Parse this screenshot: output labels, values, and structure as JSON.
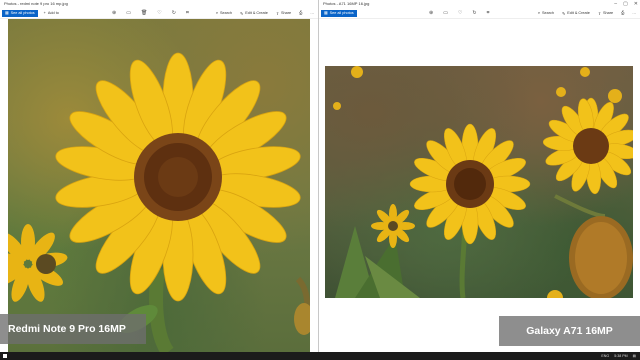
{
  "left_window": {
    "title": "Photos - redmi note 9 pro 16 mp.jpg",
    "see_all": "See all photos",
    "add_to": "Add to",
    "search": "Search",
    "edit_create": "Edit & Create",
    "share": "Share",
    "caption": "Redmi Note 9 Pro 16MP"
  },
  "right_window": {
    "title": "Photos - A71 16MP 16.jpg",
    "see_all": "See all photos",
    "search": "Search",
    "edit_create": "Edit & Create",
    "share": "Share",
    "caption": "Galaxy A71 16MP"
  },
  "taskbar": {
    "time": "5:38 PM",
    "lang": "ENG"
  },
  "icons": {
    "zoom": "zoom-icon",
    "slideshow": "slideshow-icon",
    "delete": "trash-icon",
    "favorite": "heart-icon",
    "rotate": "rotate-icon",
    "crop": "crop-icon",
    "print": "print-icon",
    "more": "more-icon"
  },
  "colors": {
    "accent": "#0a64c8",
    "petal": "#f2c21a",
    "center": "#6b3a14",
    "caption_bg": "#6e6e6e"
  }
}
